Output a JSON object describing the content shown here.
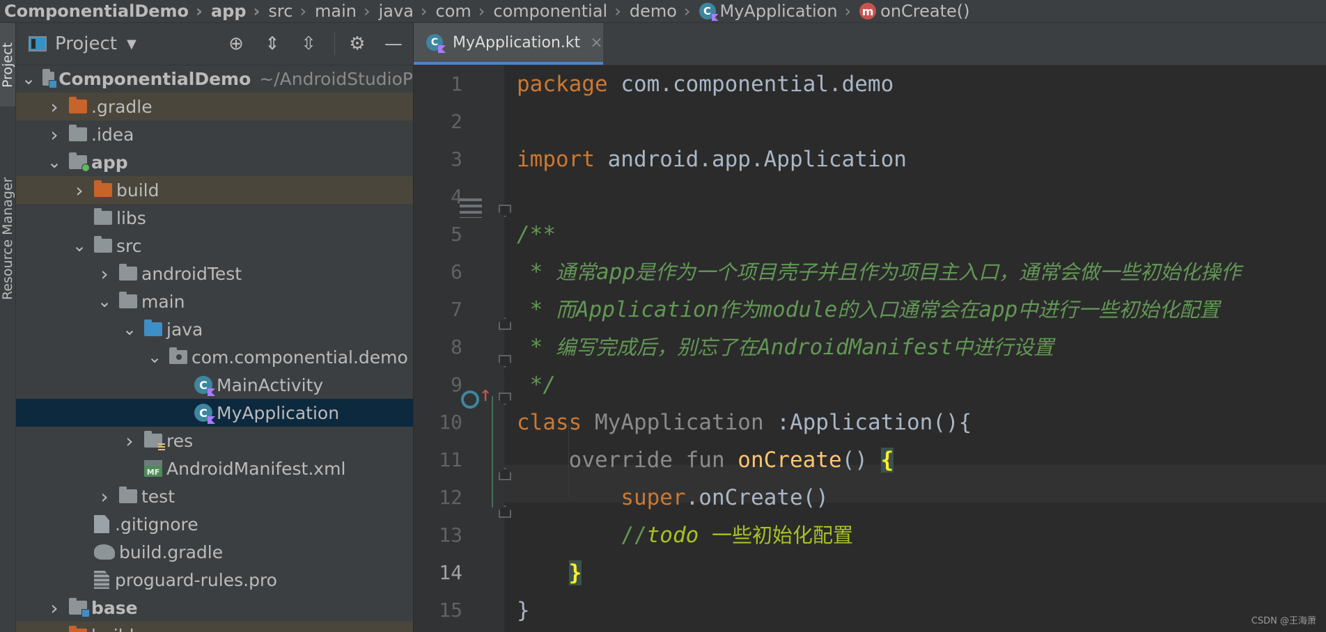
{
  "breadcrumb": [
    {
      "label": "ComponentialDemo",
      "bold": true
    },
    {
      "label": "app",
      "bold": true
    },
    {
      "label": "src"
    },
    {
      "label": "main"
    },
    {
      "label": "java"
    },
    {
      "label": "com"
    },
    {
      "label": "componential"
    },
    {
      "label": "demo"
    },
    {
      "label": "MyApplication",
      "icon": "kotlin-class-icon"
    },
    {
      "label": "onCreate()",
      "icon": "method-icon",
      "icon_glyph": "m"
    }
  ],
  "side_tabs": {
    "project": "Project",
    "resource_manager": "Resource Manager"
  },
  "project_panel": {
    "title": "Project",
    "toolbar_icons": [
      "locate-icon",
      "expand-all-icon",
      "collapse-all-icon",
      "gear-icon",
      "minimize-icon"
    ],
    "tree": [
      {
        "label": "ComponentialDemo",
        "suffix": "~/AndroidStudioP",
        "indent": 0,
        "arrow": "down",
        "icon": "module-folder",
        "bold": true
      },
      {
        "label": ".gradle",
        "indent": 1,
        "arrow": "right",
        "icon": "folder-orange",
        "excluded": true
      },
      {
        "label": ".idea",
        "indent": 1,
        "arrow": "right",
        "icon": "folder"
      },
      {
        "label": "app",
        "indent": 1,
        "arrow": "down",
        "icon": "app-module-folder",
        "bold": true
      },
      {
        "label": "build",
        "indent": 2,
        "arrow": "right",
        "icon": "folder-orange",
        "excluded": true
      },
      {
        "label": "libs",
        "indent": 2,
        "arrow": "none",
        "icon": "folder"
      },
      {
        "label": "src",
        "indent": 2,
        "arrow": "down",
        "icon": "folder"
      },
      {
        "label": "androidTest",
        "indent": 3,
        "arrow": "right",
        "icon": "folder"
      },
      {
        "label": "main",
        "indent": 3,
        "arrow": "down",
        "icon": "folder"
      },
      {
        "label": "java",
        "indent": 4,
        "arrow": "down",
        "icon": "folder-blue"
      },
      {
        "label": "com.componential.demo",
        "indent": 5,
        "arrow": "down",
        "icon": "package-folder"
      },
      {
        "label": "MainActivity",
        "indent": 6,
        "arrow": "none",
        "icon": "kotlin-class"
      },
      {
        "label": "MyApplication",
        "indent": 6,
        "arrow": "none",
        "icon": "kotlin-class",
        "selected": true
      },
      {
        "label": "res",
        "indent": 4,
        "arrow": "right",
        "icon": "res-folder"
      },
      {
        "label": "AndroidManifest.xml",
        "indent": 4,
        "arrow": "none",
        "icon": "manifest"
      },
      {
        "label": "test",
        "indent": 3,
        "arrow": "right",
        "icon": "folder"
      },
      {
        "label": ".gitignore",
        "indent": 2,
        "arrow": "none",
        "icon": "gitignore-file"
      },
      {
        "label": "build.gradle",
        "indent": 2,
        "arrow": "none",
        "icon": "gradle-file"
      },
      {
        "label": "proguard-rules.pro",
        "indent": 2,
        "arrow": "none",
        "icon": "text-file"
      },
      {
        "label": "base",
        "indent": 1,
        "arrow": "right",
        "icon": "module-folder",
        "bold": true
      },
      {
        "label": "build",
        "indent": 1,
        "arrow": "right",
        "icon": "folder-orange",
        "excluded": true
      }
    ],
    "manifest_badge": "MF"
  },
  "editor": {
    "tab": {
      "label": "MyApplication.kt",
      "close": "×"
    },
    "current_line": 14,
    "lines": [
      {
        "n": "1",
        "text": "package com.componential.demo"
      },
      {
        "n": "2",
        "text": ""
      },
      {
        "n": "3",
        "text": "import android.app.Application"
      },
      {
        "n": "4",
        "text": ""
      },
      {
        "n": "5",
        "text": "/**"
      },
      {
        "n": "6",
        "text": " * 通常app是作为一个项目壳子并且作为项目主入口，通常会做一些初始化操作"
      },
      {
        "n": "7",
        "text": " * 而Application作为module的入口通常会在app中进行一些初始化配置"
      },
      {
        "n": "8",
        "text": " * 编写完成后，别忘了在AndroidManifest中进行设置"
      },
      {
        "n": "9",
        "text": " */"
      },
      {
        "n": "10",
        "text": "class MyApplication :Application(){"
      },
      {
        "n": "11",
        "text": "    override fun onCreate() {"
      },
      {
        "n": "12",
        "text": "        super.onCreate()"
      },
      {
        "n": "13",
        "text": "        //todo 一些初始化配置"
      },
      {
        "n": "14",
        "text": "    }"
      },
      {
        "n": "15",
        "text": "}"
      }
    ]
  },
  "watermark": "CSDN @王海萧",
  "colors": {
    "keyword": "#cc7832",
    "function": "#ffc66d",
    "comment": "#629755",
    "todo": "#a8c023",
    "selection": "#0d293e"
  }
}
